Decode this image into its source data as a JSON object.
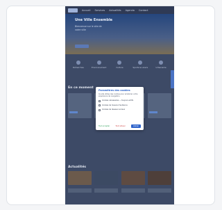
{
  "page": {
    "nav": [
      "Accueil",
      "Services",
      "Actualités",
      "Agenda",
      "Contact"
    ],
    "hero": {
      "title": "Une Ville Ensemble",
      "subtitle": "Bienvenue sur le site de votre ville",
      "button": "En savoir plus"
    },
    "quick_links": [
      "Démarches",
      "Environnement",
      "Culture",
      "Sports & Loisirs",
      "Urbanisme"
    ],
    "section_title": "En ce moment",
    "section_title2": "Actualités"
  },
  "dialog": {
    "title": "Paramètres des cookies",
    "text": "Ce site utilise des cookies pour améliorer votre expérience de navigation.",
    "options": [
      "Cookies nécessaires — toujours actifs",
      "Cookies de mesure d'audience",
      "Cookies de réseaux sociaux"
    ],
    "accept_all": "Tout accepter",
    "refuse_all": "Tout refuser",
    "save": "Valider"
  },
  "colors": {
    "accent": "#2f64cb",
    "overlay": "#3d4a66"
  }
}
